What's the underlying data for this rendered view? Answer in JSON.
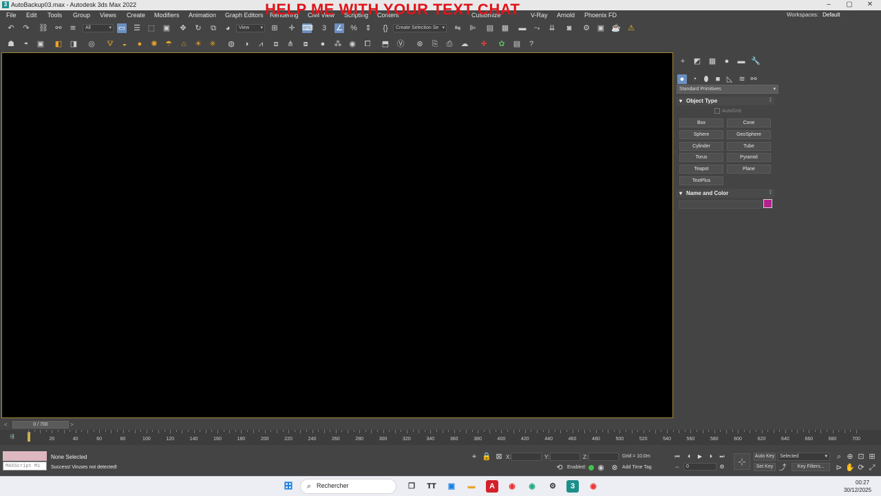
{
  "window": {
    "title": "AutoBackup03.max - Autodesk 3ds Max 2022",
    "app_icon_text": "3"
  },
  "overlay_caption": "HELP ME WITH YOUR TEXT CHAT",
  "menubar": {
    "items": [
      "File",
      "Edit",
      "Tools",
      "Group",
      "Views",
      "Create",
      "Modifiers",
      "Animation",
      "Graph Editors",
      "Rendering",
      "Civil View",
      "Scripting",
      "Content",
      "",
      "",
      "Customize",
      "",
      "V-Ray",
      "Arnold",
      "Phoenix FD"
    ],
    "workspace_label": "Workspaces:",
    "workspace_value": "Default"
  },
  "toolbar1": {
    "selection_filter": "All",
    "ref_coord": "View",
    "selection_set": "Create Selection Se"
  },
  "command_panel": {
    "category": "Standard Primitives",
    "object_type_title": "Object Type",
    "autogrid_label": "AutoGrid",
    "buttons": [
      "Box",
      "Cone",
      "Sphere",
      "GeoSphere",
      "Cylinder",
      "Tube",
      "Torus",
      "Pyramid",
      "Teapot",
      "Plane",
      "TextPlus"
    ],
    "name_color_title": "Name and Color",
    "object_color": "#b3228c"
  },
  "timeslider": {
    "frame_label": "0 / 700",
    "prev": "<",
    "next": ">"
  },
  "trackbar": {
    "ticks": [
      "20",
      "40",
      "60",
      "80",
      "100",
      "120",
      "140",
      "160",
      "180",
      "200",
      "220",
      "240",
      "260",
      "280",
      "300",
      "320",
      "340",
      "360",
      "380",
      "400",
      "420",
      "440",
      "460",
      "480",
      "500",
      "520",
      "540",
      "560",
      "580",
      "600",
      "620",
      "640",
      "660",
      "680",
      "700"
    ]
  },
  "status": {
    "maxscript_label": "MAXScript Mi",
    "selection": "None Selected",
    "prompt": "Success! Viruses not detected!",
    "x_label": "X:",
    "y_label": "Y:",
    "z_label": "Z:",
    "grid": "Grid = 10.0m",
    "enabled_label": "Enabled:",
    "add_time_tag": "Add Time Tag",
    "frame_value": "0",
    "auto_key": "Auto Key",
    "set_key": "Set Key",
    "selected_option": "Selected",
    "key_filters": "Key Filters..."
  },
  "taskbar": {
    "search_placeholder": "Rechercher",
    "time": "00:27",
    "date": "30/12/2025"
  }
}
